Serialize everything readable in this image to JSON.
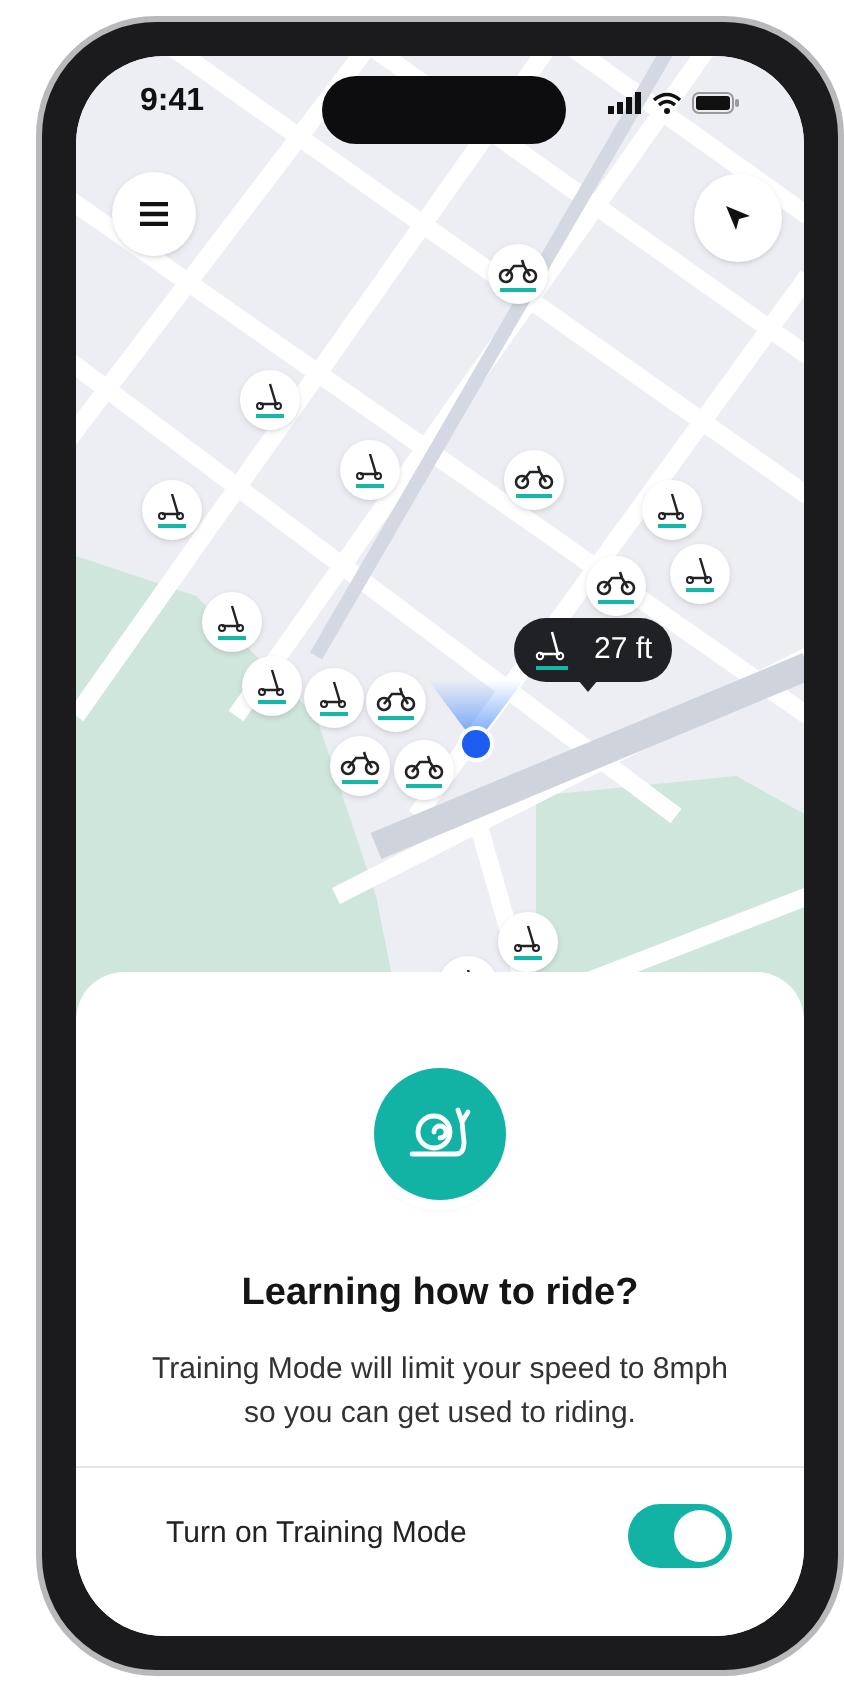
{
  "status_bar": {
    "time": "9:41"
  },
  "map": {
    "distance_tooltip": "27 ft"
  },
  "card": {
    "title": "Learning how to ride?",
    "body": "Training Mode will limit your speed to 8mph so you can get used to riding.",
    "toggle": {
      "label": "Turn on Training Mode",
      "on": true
    }
  }
}
